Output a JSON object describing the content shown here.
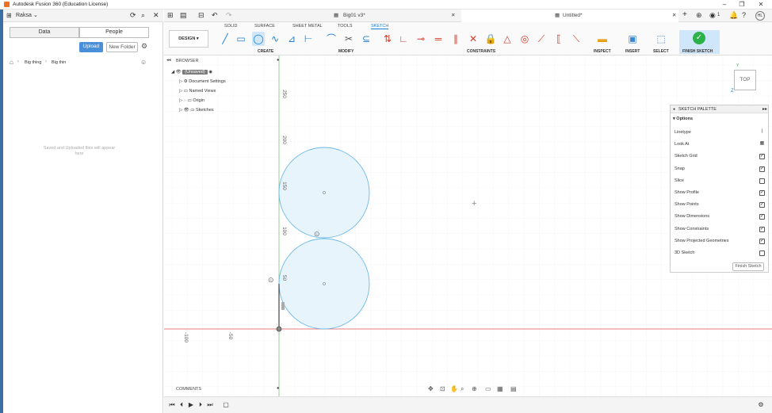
{
  "window": {
    "title": "Autodesk Fusion 360 (Education License)",
    "minimize": "–",
    "maximize": "❐",
    "close": "✕"
  },
  "data_panel": {
    "team": "Raksa",
    "tabs": [
      "Data",
      "People"
    ],
    "upload_label": "Upload",
    "new_folder_label": "New Folder",
    "breadcrumb": [
      "Big thing",
      "Big thin"
    ],
    "empty_message": "Saved and Uploaded files will appear here"
  },
  "app_bar": {
    "tab_inactive": "Big01 v3*",
    "tab_active": "Untitled*",
    "badge": "1",
    "user": "HL"
  },
  "ribbon": {
    "workspace": "DESIGN",
    "tabs": [
      "SOLID",
      "SURFACE",
      "SHEET METAL",
      "TOOLS",
      "SKETCH"
    ],
    "groups": [
      "CREATE",
      "MODIFY",
      "CONSTRAINTS",
      "INSPECT",
      "INSERT",
      "SELECT",
      "FINISH SKETCH"
    ]
  },
  "browser": {
    "title": "BROWSER",
    "root": "(Unsaved)",
    "items": [
      "Document Settings",
      "Named Views",
      "Origin",
      "Sketches"
    ]
  },
  "view_cube": {
    "label": "TOP",
    "axis_z": "Z",
    "axis_y": "Y"
  },
  "ruler": {
    "vertical": [
      "250",
      "200",
      "150",
      "100",
      "50"
    ],
    "horizontal": [
      "-100",
      "-50"
    ]
  },
  "palette": {
    "title": "SKETCH PALETTE",
    "section": "Options",
    "options": [
      {
        "label": "Linetype",
        "state": "icon"
      },
      {
        "label": "Look At",
        "state": "icon"
      },
      {
        "label": "Sketch Grid",
        "state": "checked"
      },
      {
        "label": "Snap",
        "state": "checked"
      },
      {
        "label": "Slice",
        "state": "unchecked"
      },
      {
        "label": "Show Profile",
        "state": "checked"
      },
      {
        "label": "Show Points",
        "state": "checked"
      },
      {
        "label": "Show Dimensions",
        "state": "checked"
      },
      {
        "label": "Show Constraints",
        "state": "checked"
      },
      {
        "label": "Show Projected Geometries",
        "state": "checked"
      },
      {
        "label": "3D Sketch",
        "state": "unchecked"
      }
    ],
    "finish_label": "Finish Sketch"
  },
  "comments": {
    "label": "COMMENTS"
  },
  "colors": {
    "accent": "#1c7ed6",
    "circle_stroke": "#6bb8e8",
    "circle_fill": "#e8f4fc",
    "axis_red": "#e05050",
    "axis_green": "#7bc67b",
    "finish_green": "#2db24a"
  }
}
